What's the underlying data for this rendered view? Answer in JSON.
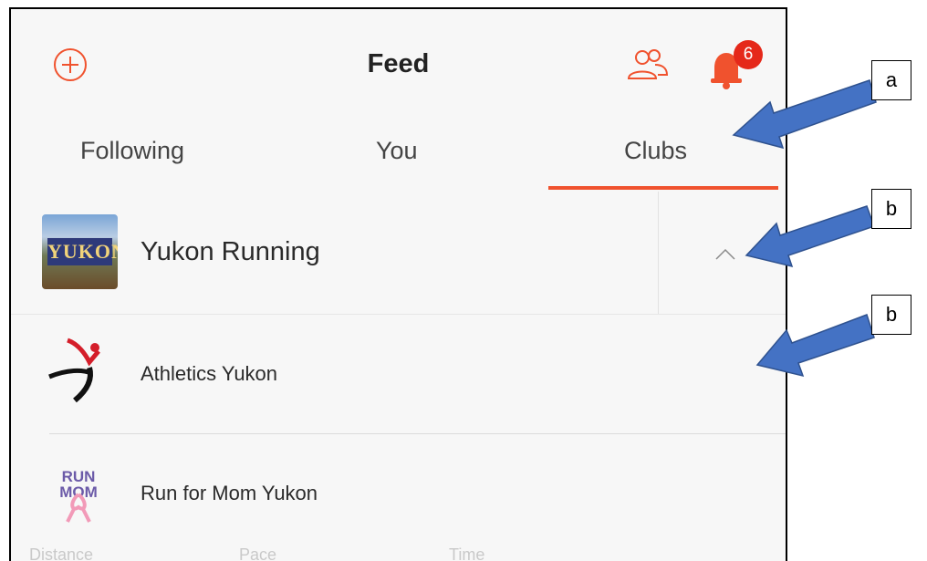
{
  "header": {
    "title": "Feed",
    "notification_count": "6",
    "add_icon": "plus-circle-icon",
    "people_icon": "people-icon",
    "bell_icon": "bell-icon"
  },
  "tabs": [
    {
      "label": "Following",
      "active": false
    },
    {
      "label": "You",
      "active": false
    },
    {
      "label": "Clubs",
      "active": true
    }
  ],
  "club": {
    "name": "Yukon Running",
    "thumb_text": "YUKON",
    "chevron_icon": "chevron-up-icon"
  },
  "list": [
    {
      "label": "Athletics Yukon",
      "icon": "athletics-yukon-logo"
    },
    {
      "label": "Run for Mom Yukon",
      "icon": "run-for-mom-logo",
      "logo_text": "RUN MOM"
    }
  ],
  "bottom_partial": [
    "Distance",
    "Pace",
    "Time"
  ],
  "annotations": [
    "a",
    "b",
    "b"
  ],
  "colors": {
    "accent": "#f0522e",
    "badge": "#e5281a",
    "arrow": "#4472c4"
  }
}
